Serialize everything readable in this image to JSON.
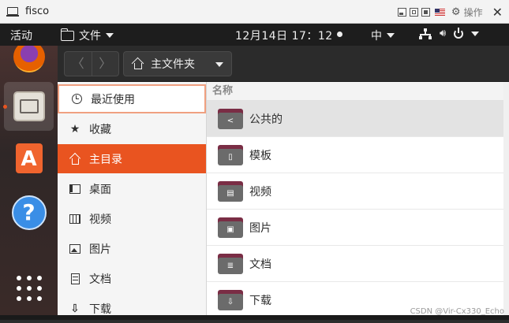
{
  "vm_window": {
    "title": "fisco",
    "operate_label": "操作",
    "close_glyph": "✕"
  },
  "topbar": {
    "activities": "活动",
    "app_menu": "文件",
    "clock": "12月14日 17：12",
    "input_method": "中"
  },
  "dock": {
    "apps": [
      "firefox-icon",
      "files-icon",
      "ubuntu-software-icon",
      "help-icon",
      "show-apps-icon"
    ]
  },
  "header": {
    "back_glyph": "〈",
    "forward_glyph": "〉",
    "location": "主文件夹"
  },
  "sidebar": {
    "items": [
      {
        "label": "最近使用",
        "icon": "recent-icon"
      },
      {
        "label": "收藏",
        "icon": "star-icon"
      },
      {
        "label": "主目录",
        "icon": "home-icon"
      },
      {
        "label": "桌面",
        "icon": "desktop-icon"
      },
      {
        "label": "视频",
        "icon": "video-icon"
      },
      {
        "label": "图片",
        "icon": "picture-icon"
      },
      {
        "label": "文档",
        "icon": "document-icon"
      },
      {
        "label": "下载",
        "icon": "download-icon"
      }
    ]
  },
  "main": {
    "column_name": "名称",
    "rows": [
      {
        "name": "公共的",
        "icon": "share-folder-icon"
      },
      {
        "name": "模板",
        "icon": "template-folder-icon"
      },
      {
        "name": "视频",
        "icon": "video-folder-icon"
      },
      {
        "name": "图片",
        "icon": "picture-folder-icon"
      },
      {
        "name": "文档",
        "icon": "document-folder-icon"
      },
      {
        "name": "下载",
        "icon": "download-folder-icon"
      }
    ]
  },
  "watermark": "CSDN @Vir-Cx330_Echo",
  "colors": {
    "accent": "#e95420",
    "folder_tab": "#7a2d45",
    "folder_body": "#6b6b6b",
    "topbar": "#1d1d1d"
  }
}
